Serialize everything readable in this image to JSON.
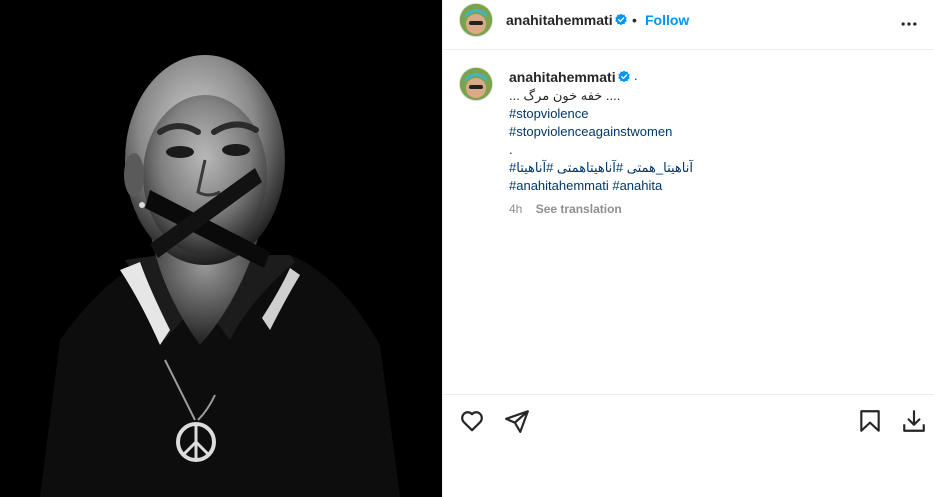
{
  "post": {
    "username": "anahitahemmati",
    "verified": true,
    "separator_dot": "•",
    "follow_label": "Follow"
  },
  "caption": {
    "username": "anahitahemmati",
    "trailing_dot": ".",
    "lines": [
      ".... خفه خون مرگ ...",
      "#stopviolence",
      "#stopviolenceagainstwomen",
      ".",
      "آناهیتا_همتی #آناهیتاهمتی #آناهیتا#",
      "#anahitahemmati #anahita"
    ],
    "time_ago": "4h",
    "see_translation": "See translation"
  },
  "photo": {
    "alt": "Black and white portrait, mouth covered with crossed black tape, wearing a peace sign necklace"
  },
  "icons": {
    "more": "more-options-icon",
    "like": "heart-icon",
    "share": "paper-plane-icon",
    "save": "bookmark-icon",
    "download": "download-icon",
    "verified": "verified-badge-icon"
  },
  "colors": {
    "link": "#0095f6",
    "hashtag": "#00376b",
    "muted": "#8e8e8e",
    "text": "#262626",
    "verified": "#0095f6"
  }
}
